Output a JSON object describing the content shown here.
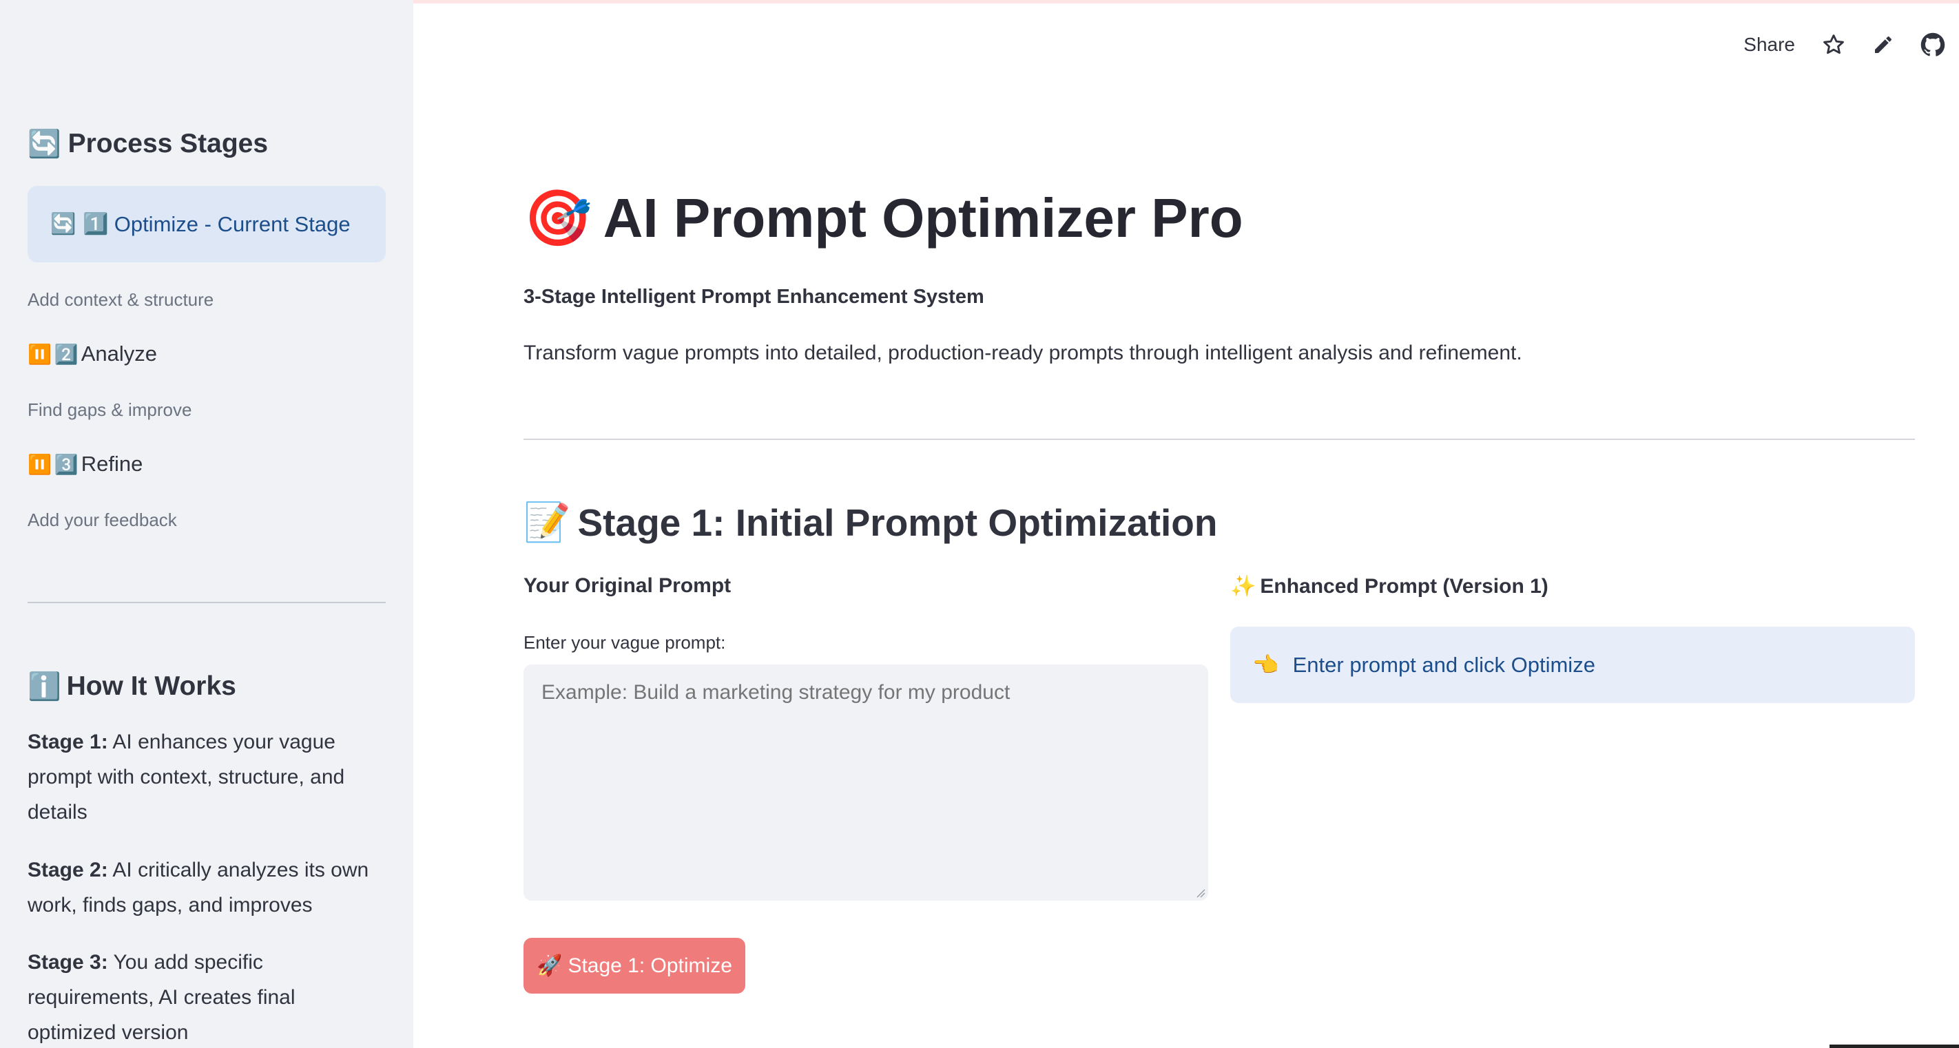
{
  "header": {
    "share_label": "Share",
    "icons": [
      "star-icon",
      "edit-icon",
      "github-icon"
    ]
  },
  "sidebar": {
    "title_emoji": "🔄",
    "title": "Process Stages",
    "current_stage": {
      "status_emoji": "🔄",
      "number_emoji": "1️⃣",
      "label": "Optimize - Current Stage",
      "description": "Add context & structure"
    },
    "stages": [
      {
        "status_emoji": "⏸️",
        "number_emoji": "2️⃣",
        "label": "Analyze",
        "description": "Find gaps & improve"
      },
      {
        "status_emoji": "⏸️",
        "number_emoji": "3️⃣",
        "label": "Refine",
        "description": "Add your feedback"
      }
    ],
    "how_it_works": {
      "title_emoji": "ℹ️",
      "title": "How It Works",
      "items": [
        {
          "label": "Stage 1:",
          "text": " AI enhances your vague prompt with context, structure, and details"
        },
        {
          "label": "Stage 2:",
          "text": " AI critically analyzes its own work, finds gaps, and improves"
        },
        {
          "label": "Stage 3:",
          "text": " You add specific requirements, AI creates final optimized version"
        }
      ]
    }
  },
  "main": {
    "title_emoji": "🎯",
    "title": "AI Prompt Optimizer Pro",
    "subtitle": "3-Stage Intelligent Prompt Enhancement System",
    "description": "Transform vague prompts into detailed, production-ready prompts through intelligent analysis and refinement.",
    "stage_heading_emoji": "📝",
    "stage_heading": "Stage 1: Initial Prompt Optimization",
    "left_column": {
      "heading": "Your Original Prompt",
      "input_label": "Enter your vague prompt:",
      "input_value": "",
      "input_placeholder": "Example: Build a marketing strategy for my product"
    },
    "right_column": {
      "heading_emoji": "✨",
      "heading": "Enhanced Prompt (Version 1)",
      "info_emoji": "👈",
      "info_text": "Enter prompt and click Optimize"
    },
    "button": {
      "emoji": "🚀",
      "label": "Stage 1: Optimize"
    }
  },
  "colors": {
    "sidebar_bg": "#f0f2f6",
    "accent_blue": "#1c4e8c",
    "info_bg": "#e8eef9",
    "current_stage_bg": "#dde7f6",
    "button_bg": "#f07b7b"
  }
}
